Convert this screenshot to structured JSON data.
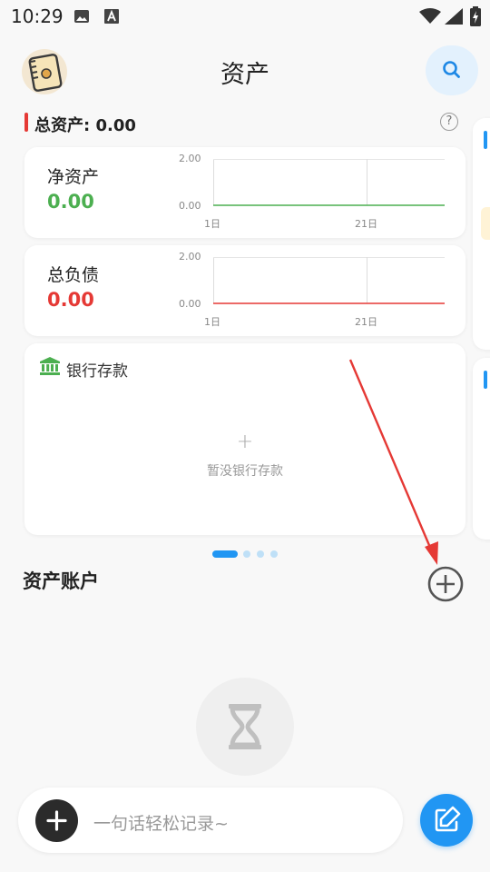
{
  "status_bar": {
    "time": "10:29"
  },
  "header": {
    "title": "资产"
  },
  "summary": {
    "total_label": "总资产: 0.00"
  },
  "cards": {
    "net_assets": {
      "label": "净资产",
      "value": "0.00",
      "y_max": "2.00",
      "y_min": "0.00",
      "x_start": "1日",
      "x_end": "21日",
      "line_color": "#4caf50"
    },
    "total_liabilities": {
      "label": "总负债",
      "value": "0.00",
      "y_max": "2.00",
      "y_min": "0.00",
      "x_start": "1日",
      "x_end": "21日",
      "line_color": "#e53935"
    },
    "bank": {
      "title": "银行存款",
      "empty_text": "暂没银行存款",
      "empty_icon": "+"
    }
  },
  "section": {
    "title": "资产账户"
  },
  "bottom_bar": {
    "placeholder": "一句话轻松记录~"
  },
  "colors": {
    "positive": "#4caf50",
    "negative": "#e53935",
    "accent": "#2196f3",
    "search_bg": "#e3f1fd"
  }
}
